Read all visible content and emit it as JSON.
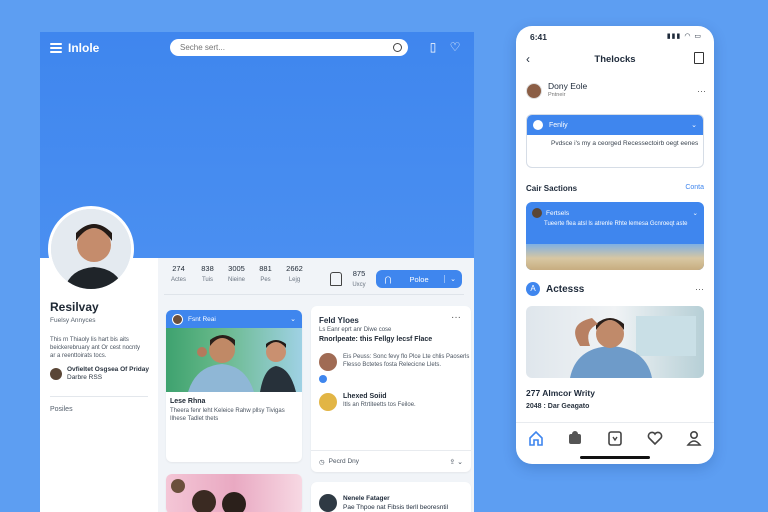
{
  "app": {
    "title": "Inlole",
    "search_placeholder": "Seche sert..."
  },
  "profile": {
    "name": "Resilvay",
    "subtitle": "Fuelsy Annyces",
    "bio": "This rn Thiaoly lis hart bis aits beickerebruary ant Or cest nocnty ar a reenttoirats tocs.",
    "work": "Ovfieltet Osgsea Of Priday",
    "work_sub": "Darbre RSS",
    "posts_label": "Posiles"
  },
  "stats": [
    {
      "n": "274",
      "l": "Actes"
    },
    {
      "n": "838",
      "l": "Tuis"
    },
    {
      "n": "3005",
      "l": "Nieine"
    },
    {
      "n": "881",
      "l": "Pes"
    },
    {
      "n": "2662",
      "l": "Lejg"
    }
  ],
  "stat_extra": {
    "n": "875",
    "l": "Uxcy"
  },
  "follow_button": "Poloe",
  "post1": {
    "author": "Fsnt Reai",
    "caption": "Lese Rhna",
    "body": "Theera fenr leht Keleice Rahw pllsy Tivigas Ilhese Tadlet thets"
  },
  "post2": {
    "title": "Feld Yloes",
    "line1": "Ls Eanr eprt anr Diwe cose",
    "line2": "Rnorlpeate: this Fellgy lecsf Flace",
    "r1": "Eis Peuss: Sonc fevy flo Plce Lte chlis Paoserls Flesso Bctetes fosta Relecicne Llets.",
    "r2_name": "Lhexed Soiid",
    "r2_text": "Itls an Rtrtiteetts tos Feiloe.",
    "foot": "Pecrd Dny"
  },
  "post3": {
    "name": "Nenele Fatager",
    "text": "Pae Thpoe nat Fibsis tlerll beoresntil"
  },
  "phone": {
    "time": "6:41",
    "title": "Thelocks",
    "user": "Dony Eole",
    "user_sub": "Pntneir",
    "notice_title": "Fenliy",
    "notice_text": "Pvdsce i's my a ceorged Recessectoirb oegt eenes",
    "section": "Cair Sactions",
    "section_more": "Conta",
    "card_title": "Fertsels",
    "card_text": "Tueerte flea atsl ls atrenle Rhte lemesa Gcnroeqt aste",
    "section2": "Actesss",
    "cap1": "277 Almcor Writy",
    "cap2": "2048 : Dar Geagato"
  }
}
